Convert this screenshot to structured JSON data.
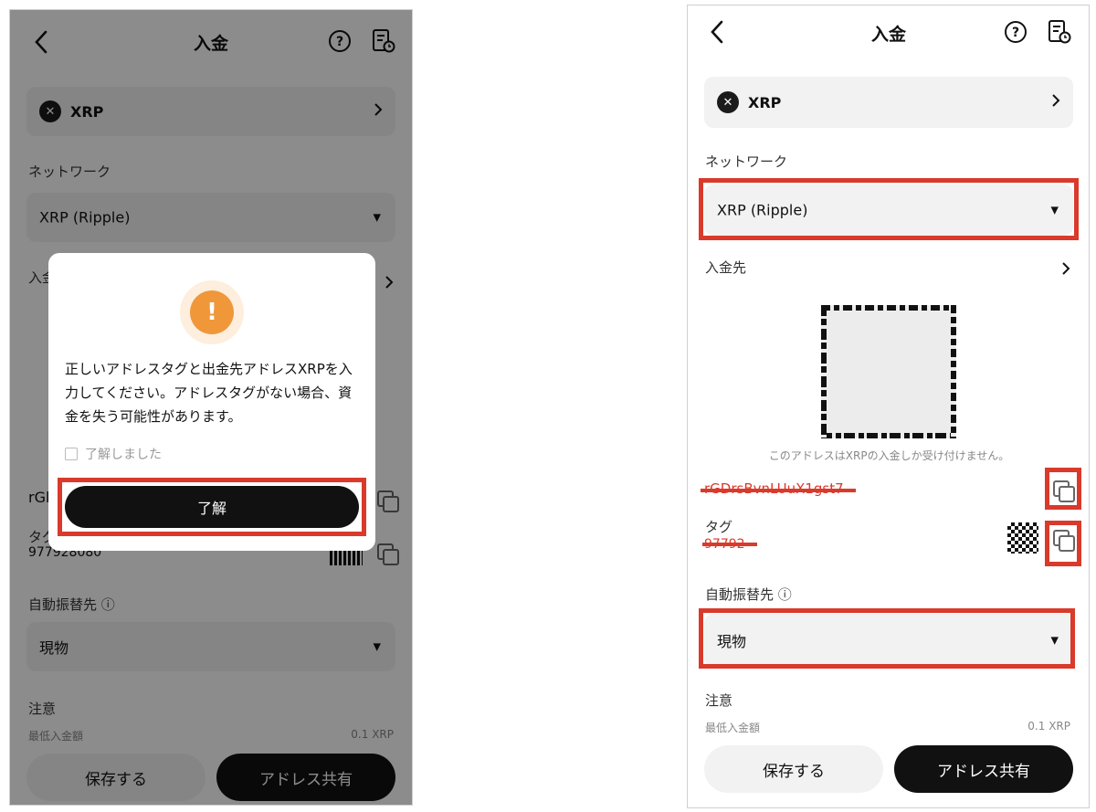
{
  "header": {
    "title": "入金",
    "back_icon": "chevron-left-icon",
    "help_icon": "question-circle-icon",
    "history_icon": "history-doc-icon"
  },
  "coin": {
    "symbol": "XRP",
    "logo_icon": "xrp-logo-icon"
  },
  "network": {
    "label": "ネットワーク",
    "value": "XRP (Ripple)"
  },
  "deposit": {
    "label": "入金先",
    "notice": "このアドレスはXRPの入金しか受け付けません。",
    "address_partial_left": "rGl",
    "address_redacted": "rGDrsBvnLUuX1gst7",
    "tag_label": "タグ",
    "tag_value_left": "977928080",
    "tag_value_right": "97792"
  },
  "auto_transfer": {
    "label": "自動振替先",
    "value": "現物"
  },
  "caution": {
    "label": "注意",
    "min_label": "最低入金額",
    "min_value": "0.1 XRP"
  },
  "buttons": {
    "save": "保存する",
    "share": "アドレス共有"
  },
  "modal": {
    "warning_icon": "exclamation-icon",
    "message": "正しいアドレスタグと出金先アドレスXRPを入力してください。アドレスタグがない場合、資金を失う可能性があります。",
    "checkbox_label": "了解しました",
    "confirm": "了解"
  },
  "colors": {
    "highlight": "#d93a2b",
    "warning": "#f0973a",
    "dark": "#111111"
  }
}
